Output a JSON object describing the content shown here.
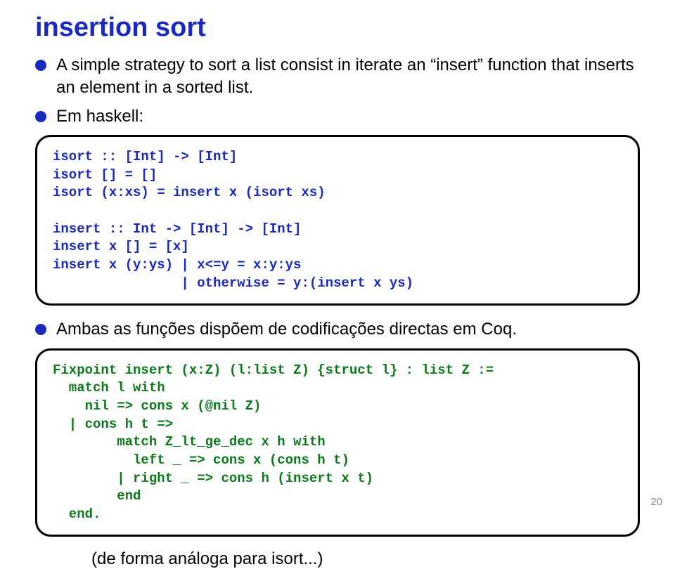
{
  "title": "insertion sort",
  "bullets": {
    "b1": "A simple strategy to sort a list consist in iterate an “insert” function that inserts an element in a sorted list.",
    "b2": "Em haskell:",
    "b3": "Ambas as funções dispõem de codificações directas em Coq."
  },
  "code": {
    "haskell": "isort :: [Int] -> [Int]\nisort [] = []\nisort (x:xs) = insert x (isort xs)\n\ninsert :: Int -> [Int] -> [Int]\ninsert x [] = [x]\ninsert x (y:ys) | x<=y = x:y:ys\n                | otherwise = y:(insert x ys)",
    "coq": "Fixpoint insert (x:Z) (l:list Z) {struct l} : list Z :=\n  match l with\n    nil => cons x (@nil Z)\n  | cons h t =>\n        match Z_lt_ge_dec x h with\n          left _ => cons x (cons h t)\n        | right _ => cons h (insert x t)\n        end\n  end."
  },
  "closing": "(de forma análoga para isort...)",
  "page": "20"
}
